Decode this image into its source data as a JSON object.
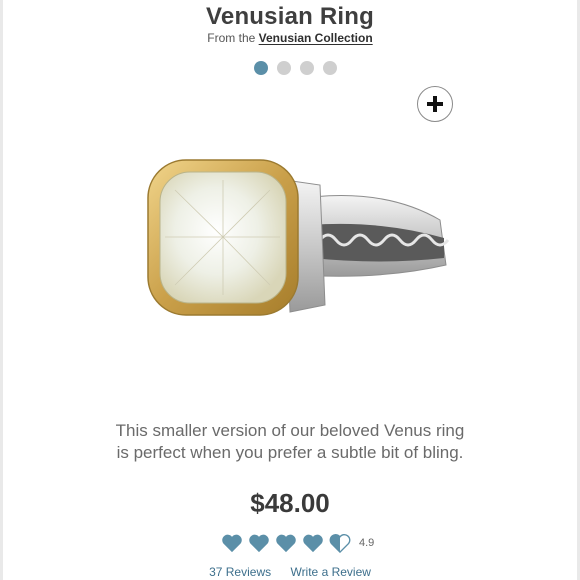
{
  "product": {
    "title": "Venusian Ring",
    "from_prefix": "From the",
    "collection_link": "Venusian Collection",
    "description_line1": "This smaller version of our beloved Venus ring",
    "description_line2": "is perfect when you prefer a subtle bit of bling.",
    "price": "$48.00"
  },
  "carousel": {
    "dots": 4,
    "active_index": 0,
    "zoom_icon": "plus-icon"
  },
  "rating": {
    "value": "4.9",
    "stars_filled": 4.9,
    "max": 5,
    "icon": "heart-icon",
    "color": "#5b8fa8"
  },
  "links": {
    "reviews": "37 Reviews",
    "write_review": "Write a Review"
  },
  "colors": {
    "accent": "#5b8fa8",
    "link": "#3d6f8c",
    "dot_inactive": "#cfcfcf"
  }
}
